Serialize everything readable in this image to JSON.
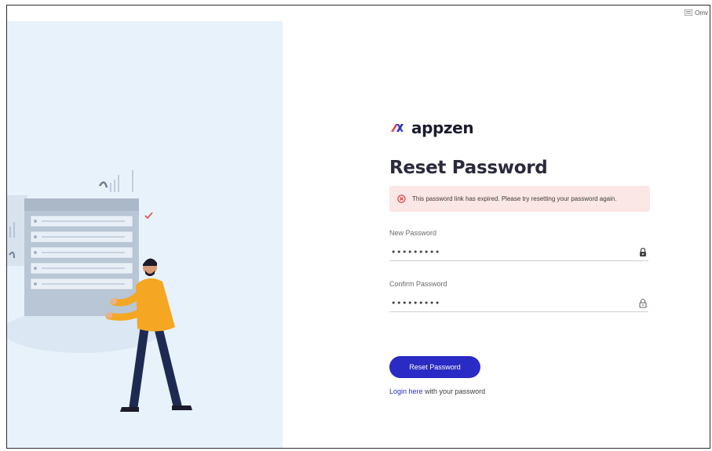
{
  "topbar": {
    "corner_label": "Omv"
  },
  "brand": {
    "name": "appzen",
    "primary_color": "#2a2bc4",
    "accent_color": "#e5484d"
  },
  "form": {
    "title": "Reset Password",
    "error_message": "This password link has expired. Please try resetting your password again.",
    "new_password": {
      "label": "New Password",
      "value": "•••••••••"
    },
    "confirm_password": {
      "label": "Confirm Password",
      "value": "•••••••••"
    },
    "submit_label": "Reset Password",
    "login": {
      "link_text": "Login here",
      "suffix": " with your password"
    }
  },
  "icons": {
    "error": "error-circle-icon",
    "lock": "lock-icon",
    "menu": "menu-icon"
  }
}
